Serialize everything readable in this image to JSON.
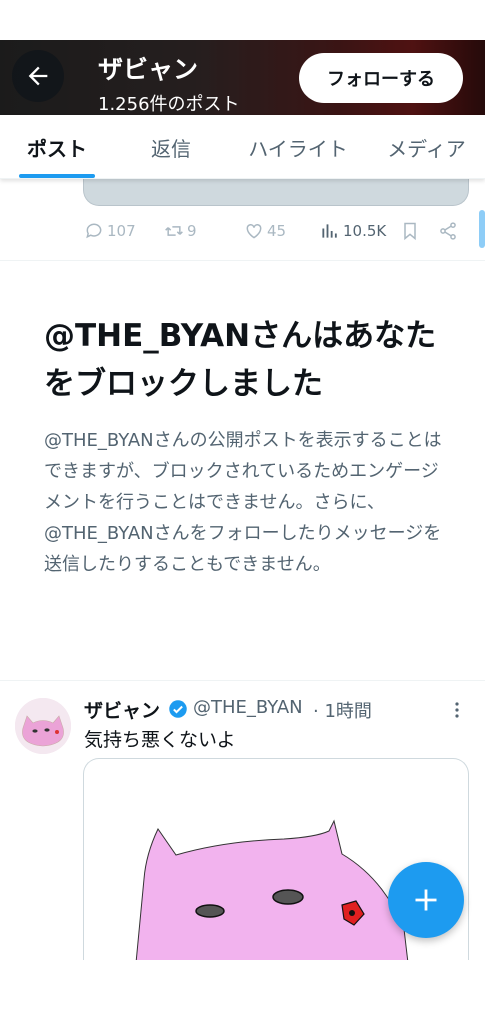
{
  "header": {
    "name": "ザビャン",
    "post_count": "1.256件のポスト",
    "follow_label": "フォローする"
  },
  "tabs": [
    {
      "label": "ポスト",
      "active": true
    },
    {
      "label": "返信",
      "active": false
    },
    {
      "label": "ハイライト",
      "active": false
    },
    {
      "label": "メディア",
      "active": false
    }
  ],
  "previous_post_actions": {
    "replies": "107",
    "reposts": "9",
    "likes": "45",
    "views": "10.5K"
  },
  "blocked_notice": {
    "title": "@THE_BYANさんはあなたをブロックしました",
    "body": "@THE_BYANさんの公開ポストを表示することはできますが、ブロックされているためエンゲージメントを行うことはできません。さらに、@THE_BYANさんをフォローしたりメッセージを送信したりすることもできません。"
  },
  "tweet": {
    "display_name": "ザビャン",
    "handle": "@THE_BYAN",
    "time": "· 1時間",
    "text": "気持ち悪くないよ",
    "verified": true
  },
  "colors": {
    "accent": "#1d9bf0",
    "text_primary": "#0f1419",
    "text_secondary": "#536471",
    "drawing_pink": "#f2b3ee",
    "drawing_red": "#e02020"
  },
  "icons": {
    "back": "arrow-left-icon",
    "reply": "speech-bubble-icon",
    "repost": "repost-arrows-icon",
    "like": "heart-icon",
    "views": "bar-chart-icon",
    "bookmark": "bookmark-icon",
    "share": "share-icon",
    "verified": "verified-badge-icon",
    "more": "vertical-dots-icon",
    "compose": "plus-icon"
  }
}
